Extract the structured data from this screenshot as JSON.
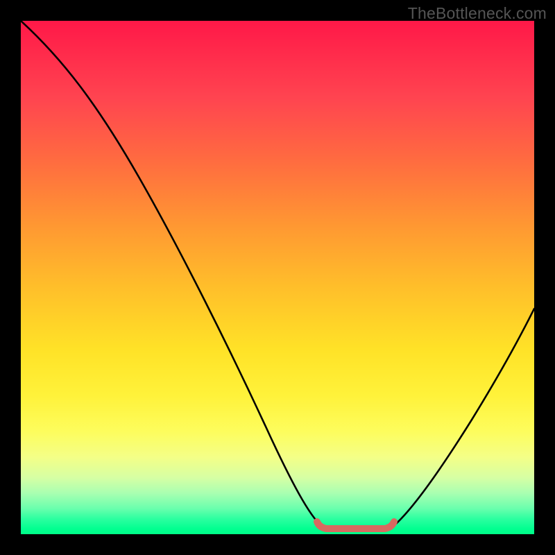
{
  "watermark": "TheBottleneck.com",
  "chart_data": {
    "type": "line",
    "title": "",
    "xlabel": "",
    "ylabel": "",
    "xlim": [
      0,
      100
    ],
    "ylim": [
      0,
      100
    ],
    "series": [
      {
        "name": "bottleneck-curve",
        "x": [
          0,
          5,
          12,
          20,
          28,
          36,
          44,
          50,
          55,
          58,
          60,
          63,
          67,
          70,
          72,
          76,
          82,
          88,
          94,
          100
        ],
        "values": [
          100,
          95,
          87,
          76,
          64,
          52,
          38,
          25,
          12,
          4,
          1,
          0.5,
          0.5,
          1,
          3,
          10,
          22,
          34,
          45,
          55
        ]
      },
      {
        "name": "flat-segment",
        "x": [
          58,
          60,
          63,
          66,
          69,
          71
        ],
        "values": [
          2.5,
          1.6,
          1.2,
          1.2,
          1.6,
          2.5
        ]
      }
    ],
    "gradient_stops": [
      {
        "pos": 0,
        "color": "#ff1848"
      },
      {
        "pos": 15,
        "color": "#ff4450"
      },
      {
        "pos": 40,
        "color": "#ff9832"
      },
      {
        "pos": 64,
        "color": "#ffe227"
      },
      {
        "pos": 85,
        "color": "#f4ff87"
      },
      {
        "pos": 95,
        "color": "#6affad"
      },
      {
        "pos": 100,
        "color": "#00ff88"
      }
    ]
  }
}
